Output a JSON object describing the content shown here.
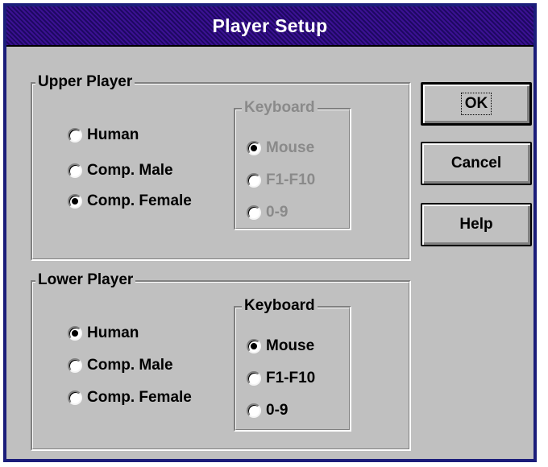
{
  "window": {
    "title": "Player Setup"
  },
  "upper_player": {
    "label": "Upper Player",
    "player_options": [
      {
        "label": "Human",
        "checked": false
      },
      {
        "label": "Comp. Male",
        "checked": false
      },
      {
        "label": "Comp. Female",
        "checked": true
      }
    ],
    "keyboard": {
      "label": "Keyboard",
      "enabled": false,
      "options": [
        {
          "label": "Mouse",
          "checked": true
        },
        {
          "label": "F1-F10",
          "checked": false
        },
        {
          "label": "0-9",
          "checked": false
        }
      ]
    }
  },
  "lower_player": {
    "label": "Lower Player",
    "player_options": [
      {
        "label": "Human",
        "checked": true
      },
      {
        "label": "Comp. Male",
        "checked": false
      },
      {
        "label": "Comp. Female",
        "checked": false
      }
    ],
    "keyboard": {
      "label": "Keyboard",
      "enabled": true,
      "options": [
        {
          "label": "Mouse",
          "checked": true
        },
        {
          "label": "F1-F10",
          "checked": false
        },
        {
          "label": "0-9",
          "checked": false
        }
      ]
    }
  },
  "buttons": {
    "ok": "OK",
    "cancel": "Cancel",
    "help": "Help"
  },
  "colors": {
    "title_bar": "#2a0a78",
    "face": "#c0c0c0",
    "disabled_text": "#8a8a8a"
  }
}
